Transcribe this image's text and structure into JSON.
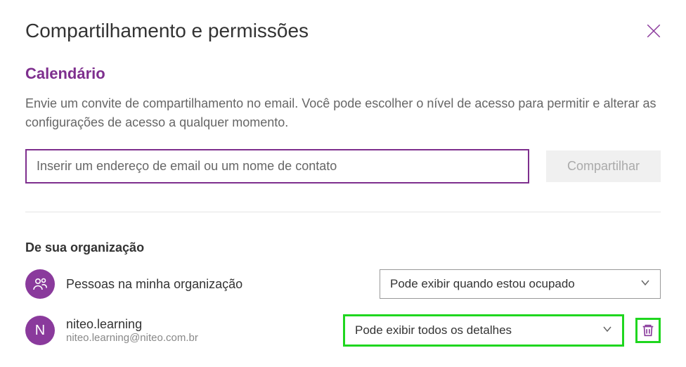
{
  "header": {
    "title": "Compartilhamento e permissões"
  },
  "calendar": {
    "subtitle": "Calendário",
    "description": "Envie um convite de compartilhamento no email. Você pode escolher o nível de acesso para permitir e alterar as configurações de acesso a qualquer momento."
  },
  "emailInput": {
    "placeholder": "Inserir um endereço de email ou um nome de contato"
  },
  "shareButton": {
    "label": "Compartilhar"
  },
  "organization": {
    "sectionLabel": "De sua organização",
    "rows": [
      {
        "name": "Pessoas na minha organização",
        "email": "",
        "avatarType": "people",
        "permission": "Pode exibir quando estou ocupado",
        "highlighted": false,
        "deletable": false
      },
      {
        "name": "niteo.learning",
        "email": "niteo.learning@niteo.com.br",
        "avatarType": "letter",
        "avatarLetter": "N",
        "permission": "Pode exibir todos os detalhes",
        "highlighted": true,
        "deletable": true
      }
    ]
  }
}
